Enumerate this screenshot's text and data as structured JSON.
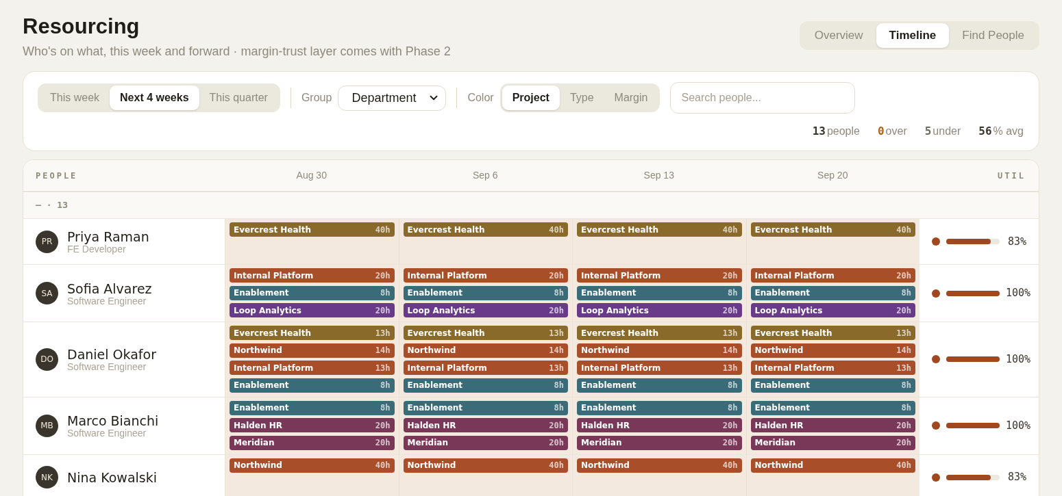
{
  "header": {
    "title": "Resourcing",
    "subtitle": "Who's on what, this week and forward · margin-trust layer comes with Phase 2"
  },
  "view_tabs": [
    {
      "label": "Overview",
      "selected": false
    },
    {
      "label": "Timeline",
      "selected": true
    },
    {
      "label": "Find People",
      "selected": false
    }
  ],
  "filters": {
    "range_tabs": [
      {
        "label": "This week",
        "selected": false
      },
      {
        "label": "Next 4 weeks",
        "selected": true
      },
      {
        "label": "This quarter",
        "selected": false
      }
    ],
    "group_label": "Group",
    "group_value": "Department",
    "color_label": "Color",
    "color_tabs": [
      {
        "label": "Project",
        "selected": true
      },
      {
        "label": "Type",
        "selected": false
      },
      {
        "label": "Margin",
        "selected": false
      }
    ],
    "search": {
      "placeholder": "Search people..."
    },
    "stats": [
      {
        "count": "13",
        "unit": "people",
        "kind": "strong"
      },
      {
        "count": "0",
        "unit": "over",
        "kind": "warn"
      },
      {
        "count": "5",
        "unit": "under",
        "kind": "muted"
      },
      {
        "count": "56",
        "unit": "% avg",
        "kind": "strong"
      }
    ]
  },
  "table": {
    "people_heading": "PEOPLE",
    "weeks": [
      "Aug 30",
      "Sep 6",
      "Sep 13",
      "Sep 20"
    ],
    "util_heading": "UTIL",
    "group_row": "— · 13",
    "people": [
      {
        "initials": "PR",
        "name": "Priya Raman",
        "role": "FE Developer",
        "level": 0.83,
        "util": "83%",
        "weeks": [
          [
            {
              "project": "Evercrest Health",
              "hours": "40h",
              "color": "#8a6a2a"
            }
          ],
          [
            {
              "project": "Evercrest Health",
              "hours": "40h",
              "color": "#8a6a2a"
            }
          ],
          [
            {
              "project": "Evercrest Health",
              "hours": "40h",
              "color": "#8a6a2a"
            }
          ],
          [
            {
              "project": "Evercrest Health",
              "hours": "40h",
              "color": "#8a6a2a"
            }
          ]
        ]
      },
      {
        "initials": "SA",
        "name": "Sofia Alvarez",
        "role": "Software Engineer",
        "level": 1,
        "util": "100%",
        "weeks": [
          [
            {
              "project": "Internal Platform",
              "hours": "20h",
              "color": "#a84f2a"
            },
            {
              "project": "Enablement",
              "hours": "8h",
              "color": "#3a6b78"
            },
            {
              "project": "Loop Analytics",
              "hours": "20h",
              "color": "#6a3a8a"
            }
          ],
          [
            {
              "project": "Internal Platform",
              "hours": "20h",
              "color": "#a84f2a"
            },
            {
              "project": "Enablement",
              "hours": "8h",
              "color": "#3a6b78"
            },
            {
              "project": "Loop Analytics",
              "hours": "20h",
              "color": "#6a3a8a"
            }
          ],
          [
            {
              "project": "Internal Platform",
              "hours": "20h",
              "color": "#a84f2a"
            },
            {
              "project": "Enablement",
              "hours": "8h",
              "color": "#3a6b78"
            },
            {
              "project": "Loop Analytics",
              "hours": "20h",
              "color": "#6a3a8a"
            }
          ],
          [
            {
              "project": "Internal Platform",
              "hours": "20h",
              "color": "#a84f2a"
            },
            {
              "project": "Enablement",
              "hours": "8h",
              "color": "#3a6b78"
            },
            {
              "project": "Loop Analytics",
              "hours": "20h",
              "color": "#6a3a8a"
            }
          ]
        ]
      },
      {
        "initials": "DO",
        "name": "Daniel Okafor",
        "role": "Software Engineer",
        "level": 1,
        "util": "100%",
        "weeks": [
          [
            {
              "project": "Evercrest Health",
              "hours": "13h",
              "color": "#8a6a2a"
            },
            {
              "project": "Northwind",
              "hours": "14h",
              "color": "#a84f2a"
            },
            {
              "project": "Internal Platform",
              "hours": "13h",
              "color": "#a84f2a"
            },
            {
              "project": "Enablement",
              "hours": "8h",
              "color": "#3a6b78"
            }
          ],
          [
            {
              "project": "Evercrest Health",
              "hours": "13h",
              "color": "#8a6a2a"
            },
            {
              "project": "Northwind",
              "hours": "14h",
              "color": "#a84f2a"
            },
            {
              "project": "Internal Platform",
              "hours": "13h",
              "color": "#a84f2a"
            },
            {
              "project": "Enablement",
              "hours": "8h",
              "color": "#3a6b78"
            }
          ],
          [
            {
              "project": "Evercrest Health",
              "hours": "13h",
              "color": "#8a6a2a"
            },
            {
              "project": "Northwind",
              "hours": "14h",
              "color": "#a84f2a"
            },
            {
              "project": "Internal Platform",
              "hours": "13h",
              "color": "#a84f2a"
            },
            {
              "project": "Enablement",
              "hours": "8h",
              "color": "#3a6b78"
            }
          ],
          [
            {
              "project": "Evercrest Health",
              "hours": "13h",
              "color": "#8a6a2a"
            },
            {
              "project": "Northwind",
              "hours": "14h",
              "color": "#a84f2a"
            },
            {
              "project": "Internal Platform",
              "hours": "13h",
              "color": "#a84f2a"
            },
            {
              "project": "Enablement",
              "hours": "8h",
              "color": "#3a6b78"
            }
          ]
        ]
      },
      {
        "initials": "MB",
        "name": "Marco Bianchi",
        "role": "Software Engineer",
        "level": 1,
        "util": "100%",
        "weeks": [
          [
            {
              "project": "Enablement",
              "hours": "8h",
              "color": "#3a6b78"
            },
            {
              "project": "Halden HR",
              "hours": "20h",
              "color": "#7a3858"
            },
            {
              "project": "Meridian",
              "hours": "20h",
              "color": "#7a3858"
            }
          ],
          [
            {
              "project": "Enablement",
              "hours": "8h",
              "color": "#3a6b78"
            },
            {
              "project": "Halden HR",
              "hours": "20h",
              "color": "#7a3858"
            },
            {
              "project": "Meridian",
              "hours": "20h",
              "color": "#7a3858"
            }
          ],
          [
            {
              "project": "Enablement",
              "hours": "8h",
              "color": "#3a6b78"
            },
            {
              "project": "Halden HR",
              "hours": "20h",
              "color": "#7a3858"
            },
            {
              "project": "Meridian",
              "hours": "20h",
              "color": "#7a3858"
            }
          ],
          [
            {
              "project": "Enablement",
              "hours": "8h",
              "color": "#3a6b78"
            },
            {
              "project": "Halden HR",
              "hours": "20h",
              "color": "#7a3858"
            },
            {
              "project": "Meridian",
              "hours": "20h",
              "color": "#7a3858"
            }
          ]
        ]
      },
      {
        "initials": "NK",
        "name": "Nina Kowalski",
        "level": 0.83,
        "util": "83%",
        "weeks": [
          [
            {
              "project": "Northwind",
              "hours": "40h",
              "color": "#a84f2a"
            }
          ],
          [
            {
              "project": "Northwind",
              "hours": "40h",
              "color": "#a84f2a"
            }
          ],
          [
            {
              "project": "Northwind",
              "hours": "40h",
              "color": "#a84f2a"
            }
          ],
          [
            {
              "project": "Northwind",
              "hours": "40h",
              "color": "#a84f2a"
            }
          ]
        ]
      }
    ]
  }
}
